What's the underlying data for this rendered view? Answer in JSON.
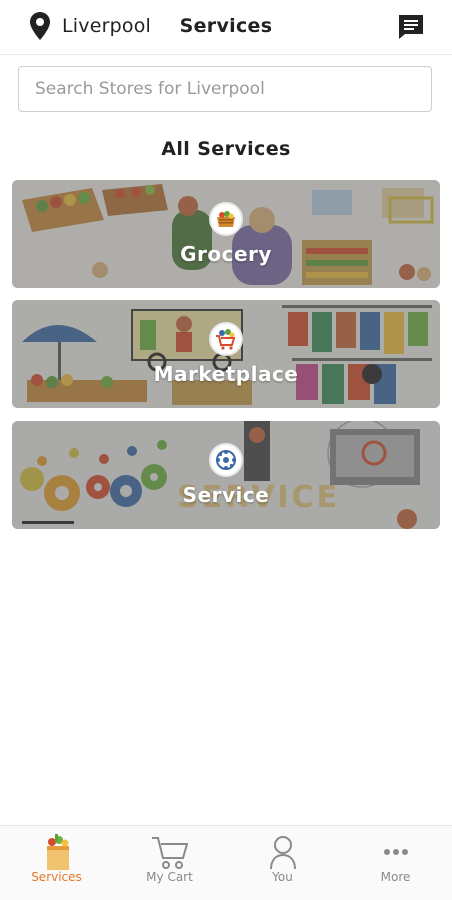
{
  "header": {
    "location": "Liverpool",
    "title": "Services"
  },
  "search": {
    "placeholder": "Search Stores for Liverpool"
  },
  "section": {
    "title": "All Services"
  },
  "services": [
    {
      "label": "Grocery",
      "icon": "grocery-basket-icon"
    },
    {
      "label": "Marketplace",
      "icon": "marketplace-cart-icon"
    },
    {
      "label": "Service",
      "icon": "service-network-icon"
    }
  ],
  "nav": {
    "items": [
      {
        "label": "Services",
        "icon": "grocery-bag-icon",
        "active": true
      },
      {
        "label": "My Cart",
        "icon": "cart-icon",
        "active": false
      },
      {
        "label": "You",
        "icon": "person-icon",
        "active": false
      },
      {
        "label": "More",
        "icon": "more-dots-icon",
        "active": false
      }
    ],
    "active_color": "#e8762b"
  }
}
